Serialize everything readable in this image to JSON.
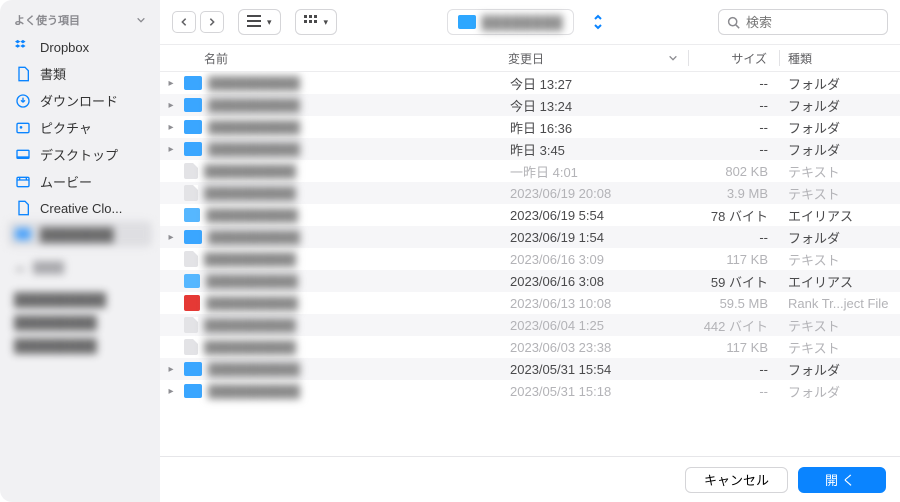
{
  "sidebar": {
    "header": "よく使う項目",
    "items": [
      {
        "label": "Dropbox",
        "icon": "dropbox"
      },
      {
        "label": "書類",
        "icon": "doc"
      },
      {
        "label": "ダウンロード",
        "icon": "download"
      },
      {
        "label": "ピクチャ",
        "icon": "picture"
      },
      {
        "label": "デスクトップ",
        "icon": "desktop"
      },
      {
        "label": "ムービー",
        "icon": "movie"
      },
      {
        "label": "Creative Clo...",
        "icon": "file"
      }
    ]
  },
  "search": {
    "placeholder": "検索"
  },
  "columns": {
    "name": "名前",
    "date": "変更日",
    "size": "サイズ",
    "kind": "種類"
  },
  "rows": [
    {
      "date": "今日 13:27",
      "size": "--",
      "kind": "フォルダ",
      "expandable": true,
      "icon": "folder",
      "dim": false
    },
    {
      "date": "今日 13:24",
      "size": "--",
      "kind": "フォルダ",
      "expandable": true,
      "icon": "folder",
      "dim": false
    },
    {
      "date": "昨日 16:36",
      "size": "--",
      "kind": "フォルダ",
      "expandable": true,
      "icon": "folder",
      "dim": false
    },
    {
      "date": "昨日 3:45",
      "size": "--",
      "kind": "フォルダ",
      "expandable": true,
      "icon": "folder",
      "dim": false
    },
    {
      "date": "一昨日 4:01",
      "size": "802 KB",
      "kind": "テキスト",
      "expandable": false,
      "icon": "doc",
      "dim": true
    },
    {
      "date": "2023/06/19 20:08",
      "size": "3.9 MB",
      "kind": "テキスト",
      "expandable": false,
      "icon": "doc",
      "dim": true
    },
    {
      "date": "2023/06/19 5:54",
      "size": "78 バイト",
      "kind": "エイリアス",
      "expandable": false,
      "icon": "alias",
      "dim": false
    },
    {
      "date": "2023/06/19 1:54",
      "size": "--",
      "kind": "フォルダ",
      "expandable": true,
      "icon": "folder",
      "dim": false
    },
    {
      "date": "2023/06/16 3:09",
      "size": "117 KB",
      "kind": "テキスト",
      "expandable": false,
      "icon": "doc",
      "dim": true
    },
    {
      "date": "2023/06/16 3:08",
      "size": "59 バイト",
      "kind": "エイリアス",
      "expandable": false,
      "icon": "alias",
      "dim": false
    },
    {
      "date": "2023/06/13 10:08",
      "size": "59.5 MB",
      "kind": "Rank Tr...ject File",
      "expandable": false,
      "icon": "rt",
      "dim": true
    },
    {
      "date": "2023/06/04 1:25",
      "size": "442 バイト",
      "kind": "テキスト",
      "expandable": false,
      "icon": "doc",
      "dim": true
    },
    {
      "date": "2023/06/03 23:38",
      "size": "117 KB",
      "kind": "テキスト",
      "expandable": false,
      "icon": "doc",
      "dim": true
    },
    {
      "date": "2023/05/31 15:54",
      "size": "--",
      "kind": "フォルダ",
      "expandable": true,
      "icon": "folder",
      "dim": false
    },
    {
      "date": "2023/05/31 15:18",
      "size": "--",
      "kind": "フォルダ",
      "expandable": true,
      "icon": "folder",
      "dim": true
    }
  ],
  "footer": {
    "cancel": "キャンセル",
    "open": "開く"
  }
}
